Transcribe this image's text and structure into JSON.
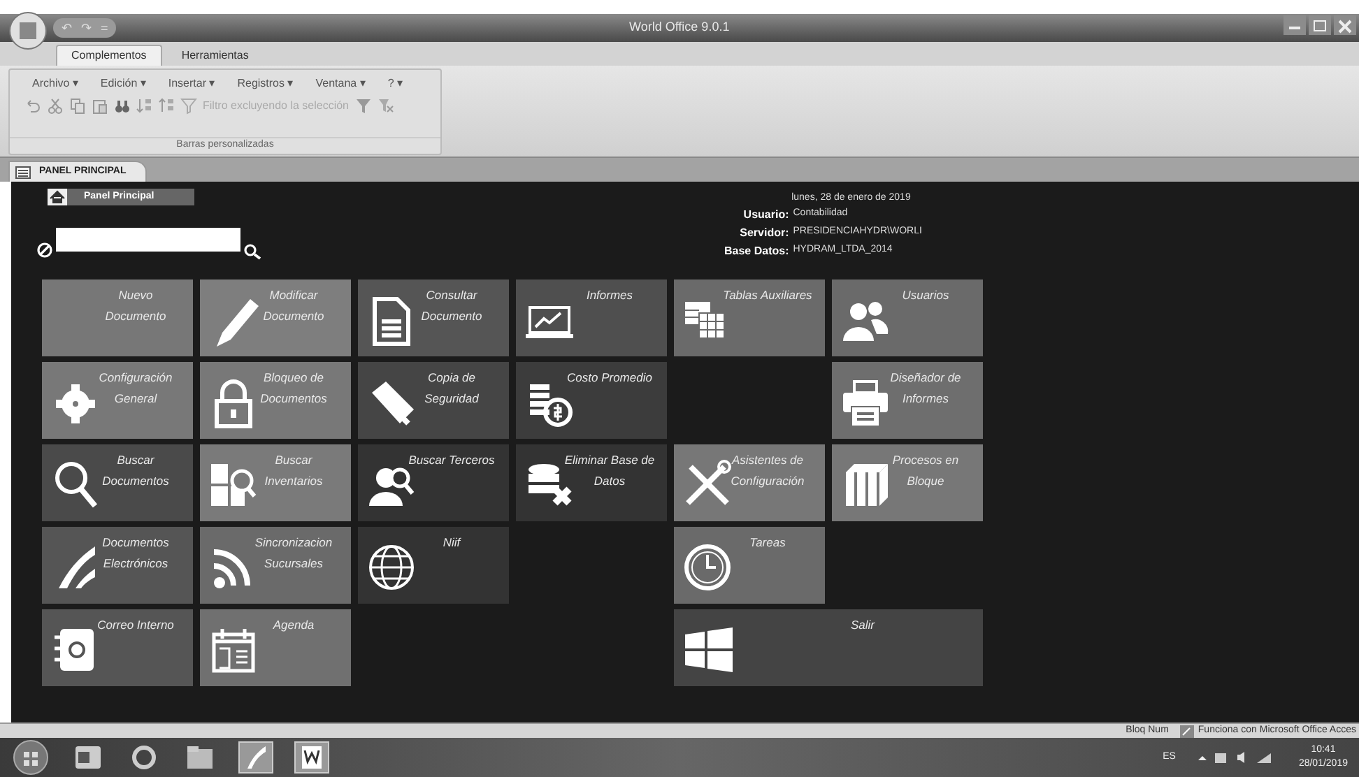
{
  "window": {
    "title": "World Office 9.0.1"
  },
  "quick_access": [
    "↶",
    "↷",
    "="
  ],
  "tabs": [
    {
      "label": "Complementos",
      "selected": true
    },
    {
      "label": "Herramientas",
      "selected": false
    }
  ],
  "menus": [
    "Archivo ▾",
    "Edición ▾",
    "Insertar ▾",
    "Registros ▾",
    "Ventana ▾",
    "? ▾"
  ],
  "toolbar": {
    "filter_label": "Filtro excluyendo la selección"
  },
  "group_label": "Barras personalizadas",
  "document_tab": "PANEL PRINCIPAL",
  "breadcrumb": "Panel Principal",
  "info": {
    "date": "lunes, 28 de enero de 2019",
    "rows": [
      {
        "label": "Usuario:",
        "value": "Contabilidad"
      },
      {
        "label": "Servidor:",
        "value": "PRESIDENCIAHYDR\\WORLI"
      },
      {
        "label": "Base Datos:",
        "value": "HYDRAM_LTDA_2014"
      }
    ]
  },
  "tiles": [
    [
      {
        "kind": "tile",
        "label": "Nuevo Documento",
        "color": "#777777"
      },
      {
        "kind": "tile",
        "label": "Modificar Documento",
        "color": "#7e7e7e"
      },
      {
        "kind": "tile",
        "label": "Consultar Documento",
        "color": "#555555"
      },
      {
        "kind": "tile",
        "label": "Informes",
        "color": "#4f4f4f"
      },
      {
        "kind": "tile",
        "label": "Tablas Auxiliares",
        "color": "#6a6a6a"
      },
      {
        "kind": "tile",
        "label": "Usuarios",
        "color": "#6a6a6a"
      }
    ],
    [
      {
        "kind": "tile",
        "label": "Configuración General",
        "color": "#787878"
      },
      {
        "kind": "tile",
        "label": "Bloqueo de Documentos",
        "color": "#787878"
      },
      {
        "kind": "tile",
        "label": "Copia de Seguridad",
        "color": "#454545"
      },
      {
        "kind": "tile",
        "label": "Costo Promedio",
        "color": "#3c3c3c"
      },
      {
        "kind": "empty"
      },
      {
        "kind": "tile",
        "label": "Diseñador de Informes",
        "color": "#6e6e6e"
      }
    ],
    [
      {
        "kind": "tile",
        "label": "Buscar Documentos",
        "color": "#4a4a4a"
      },
      {
        "kind": "tile",
        "label": "Buscar Inventarios",
        "color": "#7a7a7a"
      },
      {
        "kind": "tile",
        "label": "Buscar Terceros",
        "color": "#333333"
      },
      {
        "kind": "tile",
        "label": "Eliminar Base de Datos",
        "color": "#333333"
      },
      {
        "kind": "tile",
        "label": "Asistentes de Configuración",
        "color": "#777777"
      },
      {
        "kind": "tile",
        "label": "Procesos en Bloque",
        "color": "#777777"
      }
    ],
    [
      {
        "kind": "tile",
        "label": "Documentos Electrónicos",
        "color": "#555555"
      },
      {
        "kind": "tile",
        "label": "Sincronizacion Sucursales",
        "color": "#6a6a6a"
      },
      {
        "kind": "tile",
        "label": "Niif",
        "color": "#333333"
      },
      {
        "kind": "empty"
      },
      {
        "kind": "tile",
        "label": "Tareas",
        "color": "#6a6a6a"
      },
      {
        "kind": "empty"
      }
    ],
    [
      {
        "kind": "tile",
        "label": "Correo Interno",
        "color": "#555555"
      },
      {
        "kind": "tile",
        "label": "Agenda",
        "color": "#707070"
      },
      {
        "kind": "empty"
      },
      {
        "kind": "empty"
      },
      {
        "kind": "wide",
        "label": "Salir",
        "color": "#444444"
      }
    ]
  ],
  "status_bar": [
    "Bloq Num",
    "Funciona con Microsoft Office Acces"
  ],
  "taskbar": {
    "language": "ES",
    "time": "10:41",
    "date": "28/01/2019"
  }
}
